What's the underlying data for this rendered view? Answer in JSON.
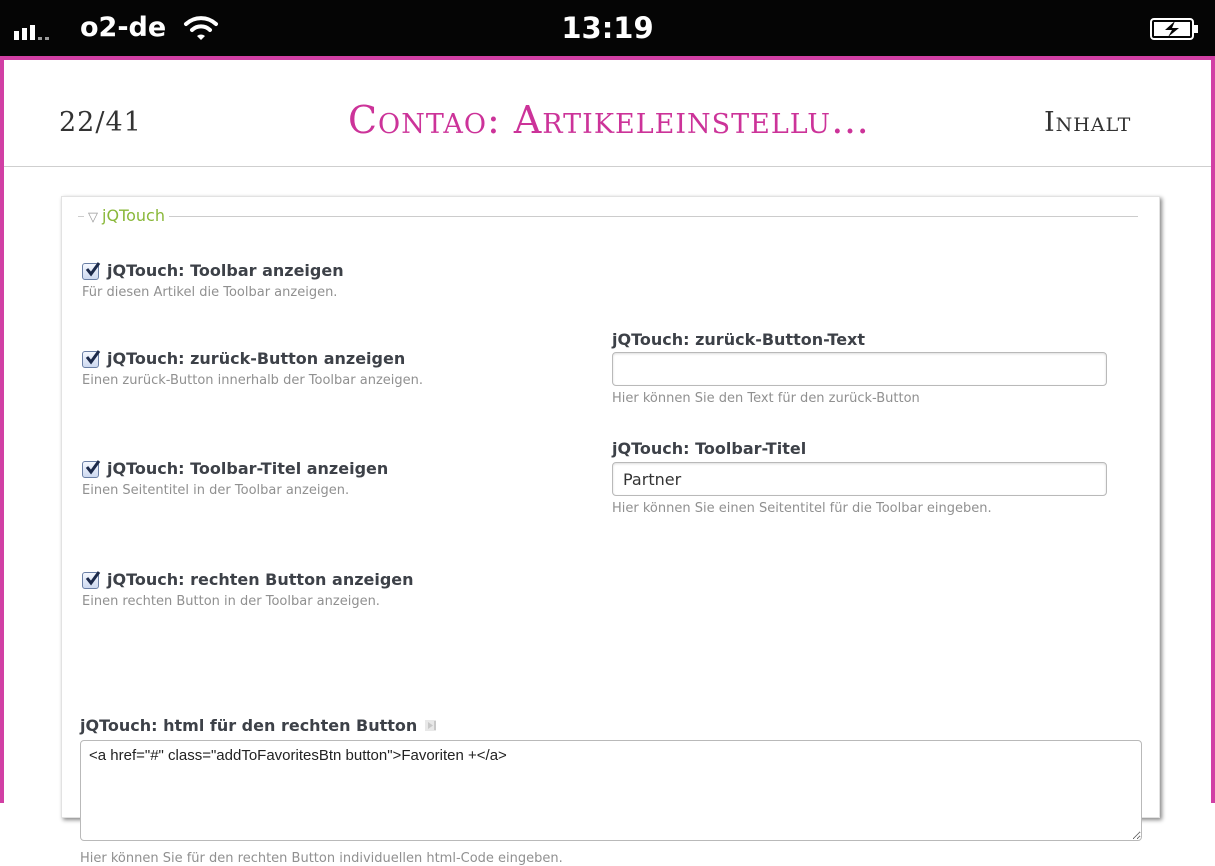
{
  "status_bar": {
    "carrier": "o2-de",
    "time": "13:19",
    "icons": [
      "signal-icon",
      "wifi-icon",
      "battery-charging-icon"
    ]
  },
  "nav": {
    "page_counter": "22/41",
    "title": "Contao: Artikeleinstellu…",
    "toc_button": "Inhalt"
  },
  "fieldset": {
    "legend": "jQTouch",
    "legend_icon": "triangle-down-icon"
  },
  "options": [
    {
      "label": "jQTouch: Toolbar anzeigen",
      "help": "Für diesen Artikel die Toolbar anzeigen.",
      "checked": true
    },
    {
      "label": "jQTouch: zurück-Button anzeigen",
      "help": "Einen zurück-Button innerhalb der Toolbar anzeigen.",
      "checked": true
    },
    {
      "label": "jQTouch: Toolbar-Titel anzeigen",
      "help": "Einen Seitentitel in der Toolbar anzeigen.",
      "checked": true
    },
    {
      "label": "jQTouch: rechten Button anzeigen",
      "help": "Einen rechten Button in der Toolbar anzeigen.",
      "checked": true
    }
  ],
  "back_button_text": {
    "label": "jQTouch: zurück-Button-Text",
    "value": "",
    "help": "Hier können Sie den Text für den zurück-Button"
  },
  "toolbar_title": {
    "label": "jQTouch: Toolbar-Titel",
    "value": "Partner",
    "help": "Hier können Sie einen Seitentitel für die Toolbar eingeben."
  },
  "right_button_html": {
    "label": "jQTouch: html für den rechten Button",
    "value": "<a href=\"#\" class=\"addToFavoritesBtn button\">Favoriten +</a>",
    "help": "Hier können Sie für den rechten Button individuellen html-Code eingeben."
  },
  "colors": {
    "accent": "#cc3399",
    "frame": "#d13fa4",
    "legend": "#8ab83a"
  }
}
